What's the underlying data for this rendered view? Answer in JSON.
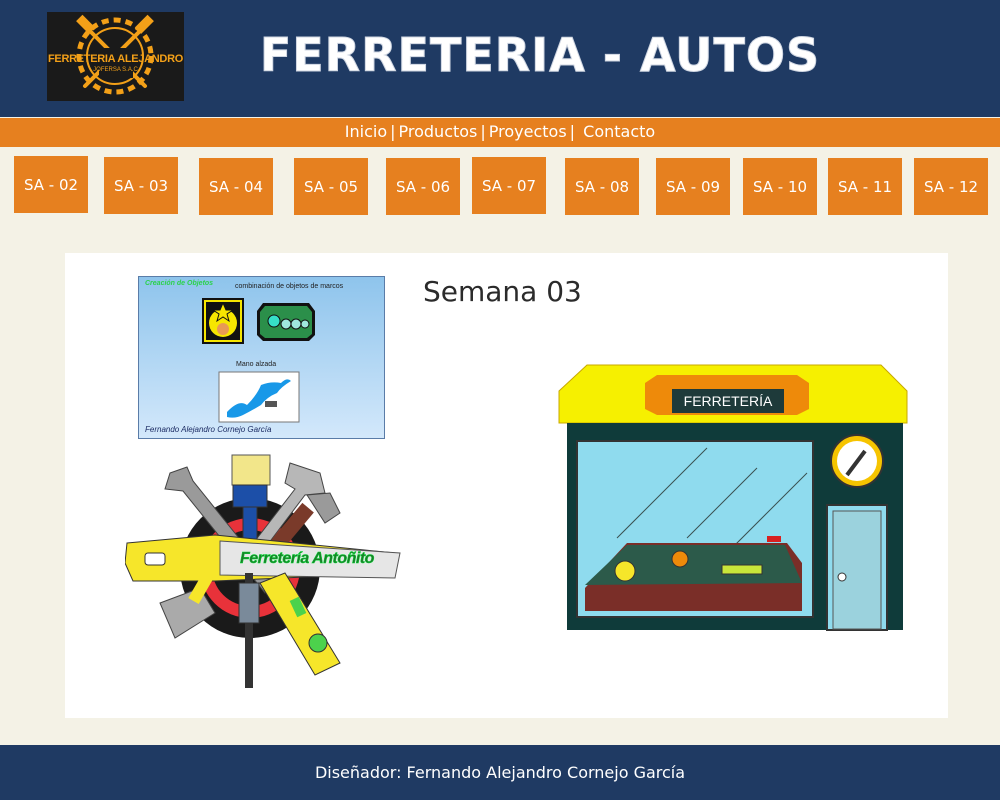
{
  "header": {
    "logo": {
      "name": "FERRETERIA ALEJANDRO",
      "subtitle": "JOFERSA S.A.C"
    },
    "title": "FERRETERIA - AUTOS"
  },
  "nav": {
    "items": [
      "Inicio",
      "Productos",
      "Proyectos",
      "Contacto"
    ],
    "separator": "|"
  },
  "weeks": [
    {
      "label": "SA - 02"
    },
    {
      "label": "SA - 03"
    },
    {
      "label": "SA - 04"
    },
    {
      "label": "SA - 05"
    },
    {
      "label": "SA - 06"
    },
    {
      "label": "SA - 07"
    },
    {
      "label": "SA - 08"
    },
    {
      "label": "SA - 09"
    },
    {
      "label": "SA - 10"
    },
    {
      "label": "SA - 11"
    },
    {
      "label": "SA - 12"
    }
  ],
  "content": {
    "title": "Semana 03",
    "screenshot": {
      "heading": "Creación de Objetos",
      "caption_top": "combinación de objetos de marcos",
      "caption_mid": "Mano alzada",
      "author": "Fernando Alejandro Cornejo García"
    },
    "tools_image": {
      "label": "Ferretería Antoñito"
    },
    "store_image": {
      "sign": "FERRETERÍA"
    }
  },
  "footer": {
    "text": "Diseñador: Fernando Alejandro Cornejo García"
  },
  "colors": {
    "navy": "#1f3a63",
    "orange": "#e6801f",
    "background": "#f4f2e6"
  }
}
